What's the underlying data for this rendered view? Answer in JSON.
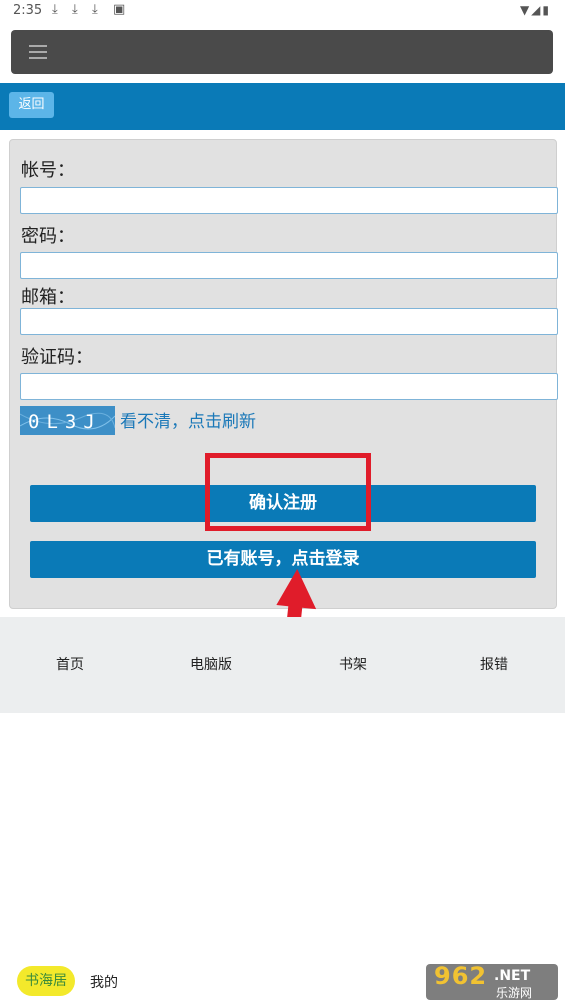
{
  "status_bar": {
    "time": "2:35",
    "downloads": [
      "⤓",
      "⤓",
      "⤓"
    ],
    "right_icons": "▼◢▮"
  },
  "nav": {
    "menu_icon": "hamburger-icon"
  },
  "toolbar": {
    "back_label": "返回"
  },
  "form": {
    "account_label": "帐号：",
    "password_label": "密码：",
    "email_label": "邮箱：",
    "captcha_label": "验证码：",
    "account_value": "",
    "password_value": "",
    "email_value": "",
    "captcha_value": "",
    "captcha_text": "0L3J",
    "refresh_text": "看不清，点击刷新",
    "register_button": "确认注册",
    "login_button": "已有账号，点击登录"
  },
  "footer": {
    "links": [
      "首页",
      "电脑版",
      "书架",
      "报错"
    ]
  },
  "bottom_bar": {
    "badge": "书海居",
    "mine": "我的"
  },
  "watermark": {
    "brand": "962",
    "net": ".NET",
    "site": "乐游网"
  },
  "colors": {
    "primary": "#0a7ab7",
    "highlight": "#e01c2a"
  }
}
